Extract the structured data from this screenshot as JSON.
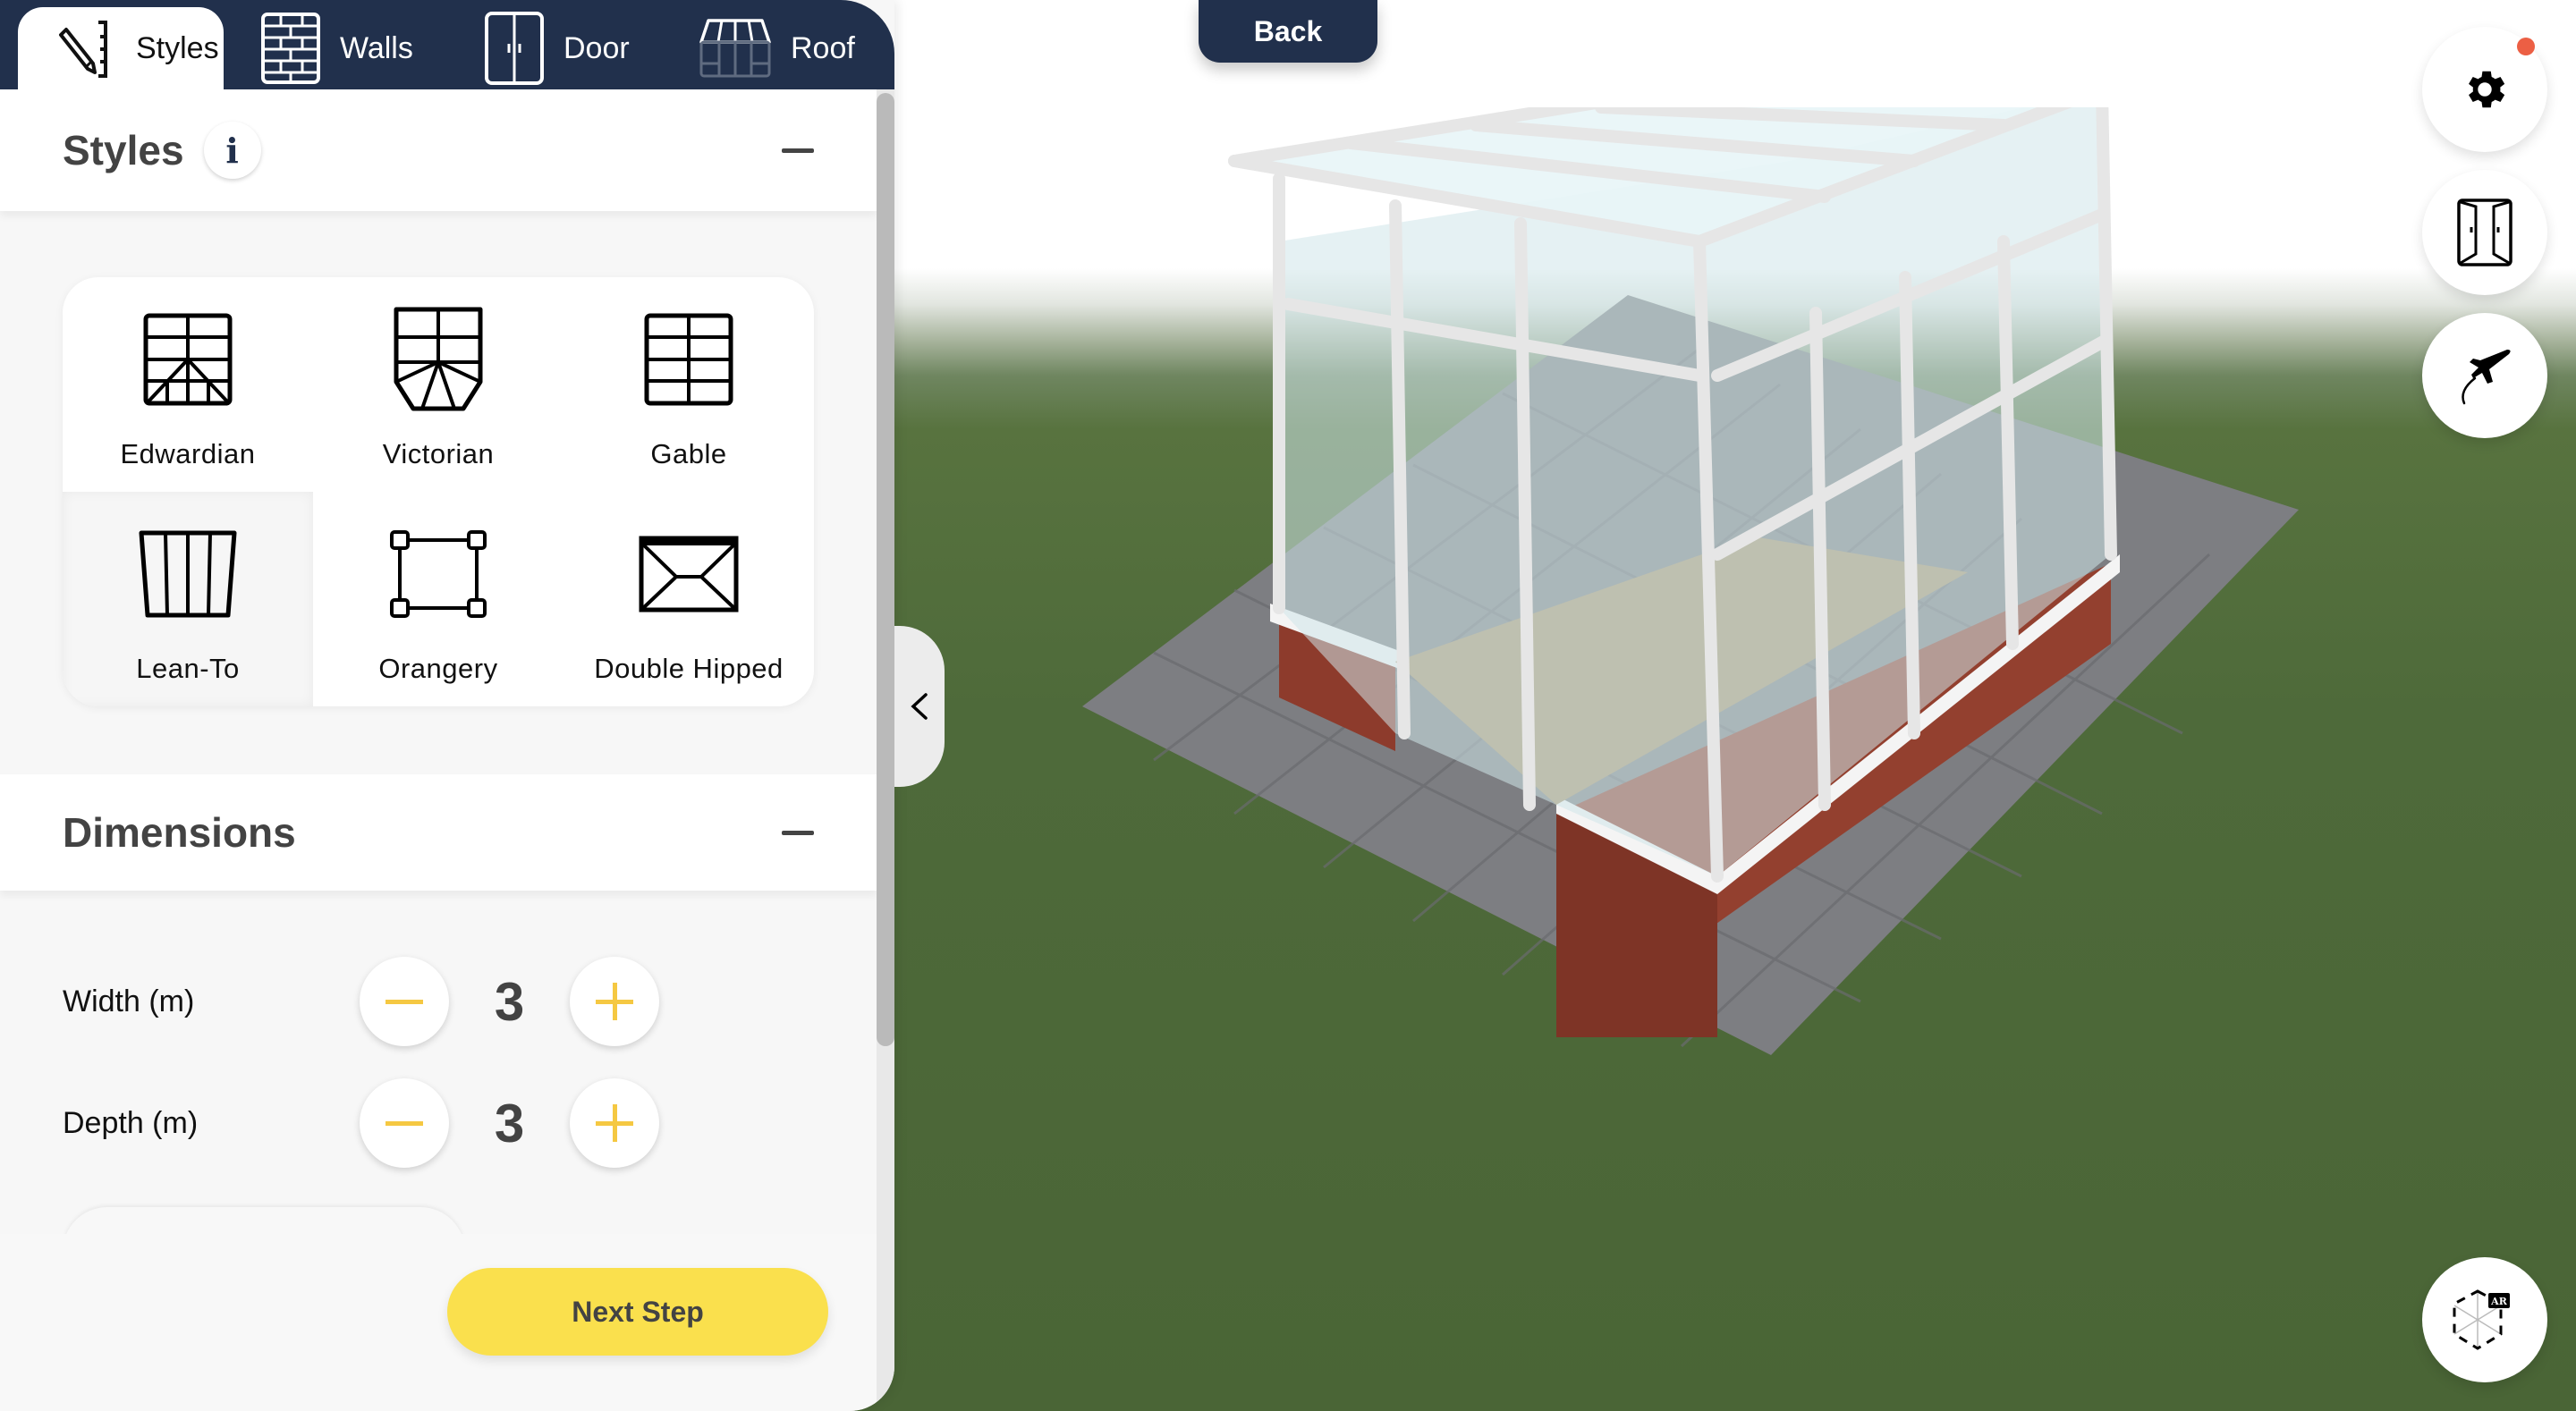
{
  "tabs": [
    {
      "label": "Styles",
      "icon": "pencil-ruler-icon",
      "active": true
    },
    {
      "label": "Walls",
      "icon": "brick-wall-icon",
      "active": false
    },
    {
      "label": "Door",
      "icon": "double-door-icon",
      "active": false
    },
    {
      "label": "Roof",
      "icon": "conservatory-roof-icon",
      "active": false
    }
  ],
  "styles_section": {
    "title": "Styles",
    "info_label": "i",
    "options": [
      {
        "label": "Edwardian",
        "icon": "edwardian-icon"
      },
      {
        "label": "Victorian",
        "icon": "victorian-icon"
      },
      {
        "label": "Gable",
        "icon": "gable-icon"
      },
      {
        "label": "Lean-To",
        "icon": "lean-to-icon",
        "selected": true
      },
      {
        "label": "Orangery",
        "icon": "orangery-icon"
      },
      {
        "label": "Double Hipped",
        "icon": "double-hipped-icon"
      }
    ]
  },
  "dimensions_section": {
    "title": "Dimensions",
    "rows": [
      {
        "label": "Width (m)",
        "value": "3"
      },
      {
        "label": "Depth (m)",
        "value": "3"
      }
    ]
  },
  "actions": {
    "next_step": "Next Step",
    "back": "Back"
  },
  "right_toolbar": [
    {
      "name": "settings",
      "icon": "gear-icon",
      "has_notification": true
    },
    {
      "name": "doors",
      "icon": "open-door-icon"
    },
    {
      "name": "fly-mode",
      "icon": "airplane-icon"
    },
    {
      "name": "ar-view",
      "icon": "ar-cube-icon",
      "badge": "AR"
    }
  ],
  "colors": {
    "navy": "#21304c",
    "accent_yellow": "#fae04d",
    "stepper_yellow": "#f5c842",
    "notification": "#ec5f44"
  }
}
